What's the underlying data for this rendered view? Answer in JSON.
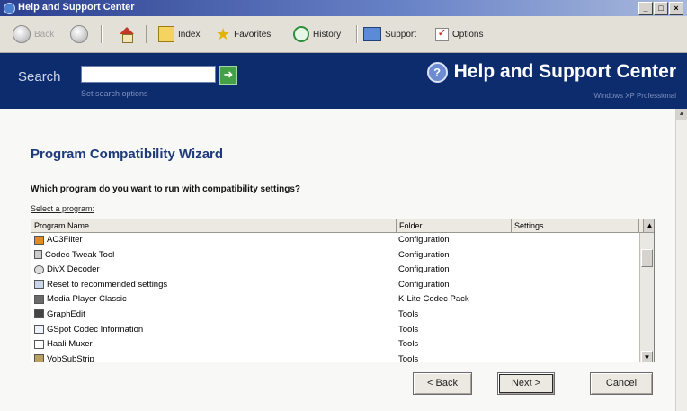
{
  "window": {
    "title": "Help and Support Center"
  },
  "toolbar": {
    "back_label": "Back",
    "index_label": "Index",
    "favorites_label": "Favorites",
    "history_label": "History",
    "support_label": "Support",
    "options_label": "Options"
  },
  "header": {
    "search_label": "Search",
    "search_value": "",
    "search_options": "Set search options",
    "title": "Help and Support Center",
    "edition": "Windows XP Professional"
  },
  "wizard": {
    "title": "Program Compatibility Wizard",
    "question": "Which program do you want to run with compatibility settings?",
    "select_label": "Select a program:",
    "columns": [
      "Program Name",
      "Folder",
      "Settings"
    ],
    "programs": [
      {
        "name": "AC3Filter",
        "folder": "Configuration",
        "icon": "ac3filter-icon"
      },
      {
        "name": "Codec Tweak Tool",
        "folder": "Configuration",
        "icon": "tool-icon"
      },
      {
        "name": "DivX Decoder",
        "folder": "Configuration",
        "icon": "disc-icon"
      },
      {
        "name": "Reset to recommended settings",
        "folder": "Configuration",
        "icon": "monitor-icon"
      },
      {
        "name": "Media Player Classic",
        "folder": "K-Lite Codec Pack",
        "icon": "media-player-icon"
      },
      {
        "name": "GraphEdit",
        "folder": "Tools",
        "icon": "graphedit-icon"
      },
      {
        "name": "GSpot Codec Information",
        "folder": "Tools",
        "icon": "document-icon"
      },
      {
        "name": "Haali Muxer",
        "folder": "Tools",
        "icon": "window-icon"
      },
      {
        "name": "VobSubStrip",
        "folder": "Tools",
        "icon": "box-icon"
      }
    ],
    "buttons": {
      "back": "< Back",
      "next": "Next >",
      "cancel": "Cancel"
    }
  }
}
